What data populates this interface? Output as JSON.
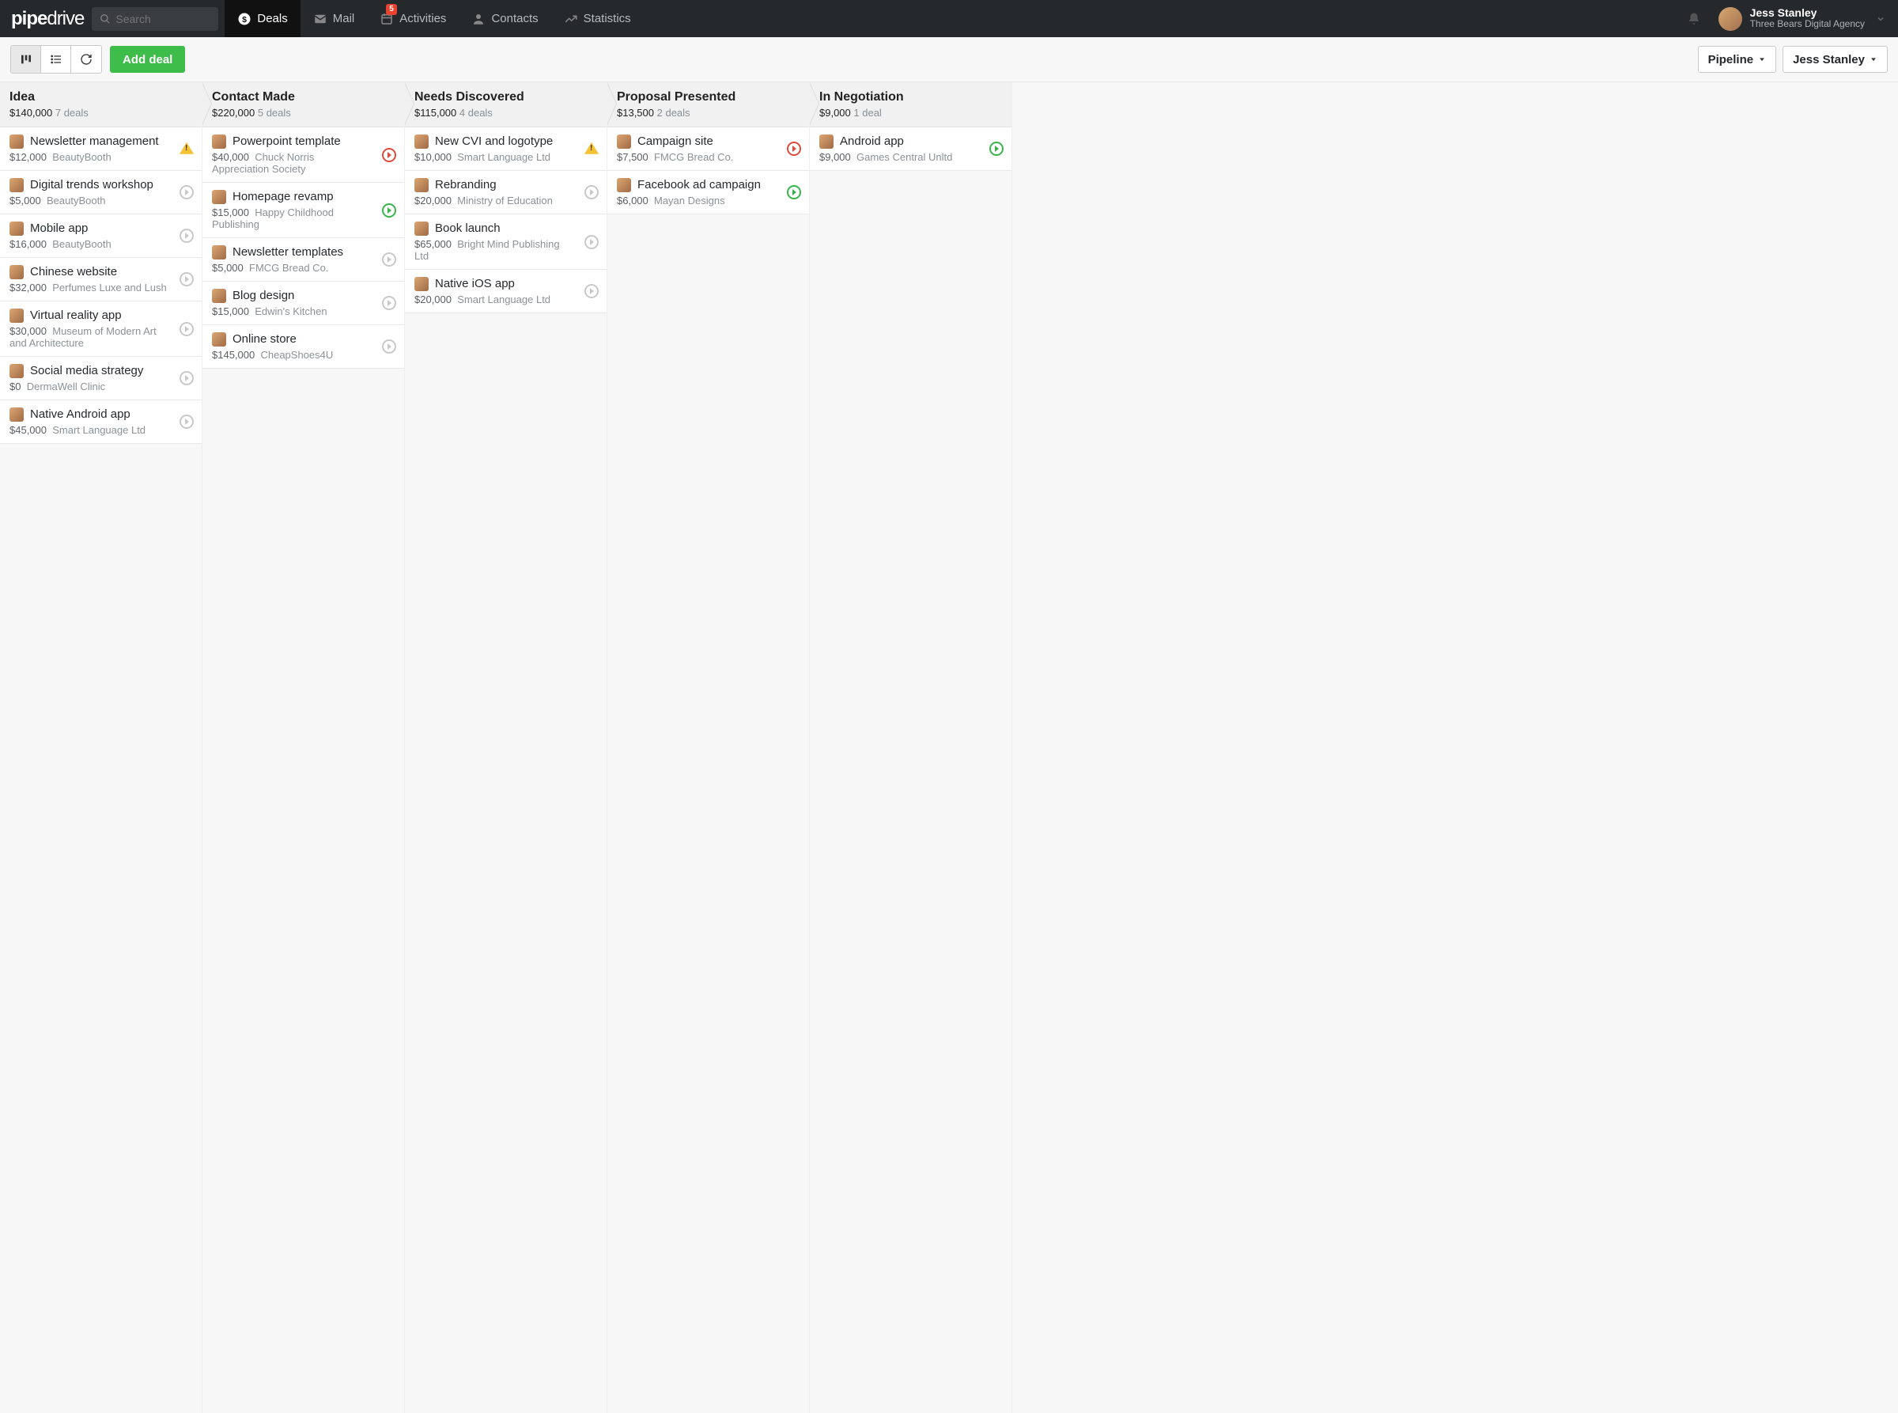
{
  "search_placeholder": "Search",
  "nav": {
    "deals": "Deals",
    "mail": "Mail",
    "activities": "Activities",
    "activities_badge": "5",
    "contacts": "Contacts",
    "statistics": "Statistics"
  },
  "user": {
    "name": "Jess Stanley",
    "org": "Three Bears Digital Agency"
  },
  "toolbar": {
    "add_deal": "Add deal",
    "pipeline": "Pipeline",
    "owner": "Jess Stanley"
  },
  "stages": [
    {
      "title": "Idea",
      "total": "$140,000",
      "count": "7 deals",
      "deals": [
        {
          "title": "Newsletter management",
          "amount": "$12,000",
          "org": "BeautyBooth",
          "status": "warn"
        },
        {
          "title": "Digital trends workshop",
          "amount": "$5,000",
          "org": "BeautyBooth",
          "status": "gray"
        },
        {
          "title": "Mobile app",
          "amount": "$16,000",
          "org": "BeautyBooth",
          "status": "gray"
        },
        {
          "title": "Chinese website",
          "amount": "$32,000",
          "org": "Perfumes Luxe and Lush",
          "status": "gray"
        },
        {
          "title": "Virtual reality app",
          "amount": "$30,000",
          "org": "Museum of Modern Art and Architecture",
          "status": "gray"
        },
        {
          "title": "Social media strategy",
          "amount": "$0",
          "org": "DermaWell Clinic",
          "status": "gray"
        },
        {
          "title": "Native Android app",
          "amount": "$45,000",
          "org": "Smart Language Ltd",
          "status": "gray"
        }
      ]
    },
    {
      "title": "Contact Made",
      "total": "$220,000",
      "count": "5 deals",
      "deals": [
        {
          "title": "Powerpoint template",
          "amount": "$40,000",
          "org": "Chuck Norris Appreciation Society",
          "status": "red"
        },
        {
          "title": "Homepage revamp",
          "amount": "$15,000",
          "org": "Happy Childhood Publishing",
          "status": "green"
        },
        {
          "title": "Newsletter templates",
          "amount": "$5,000",
          "org": "FMCG Bread Co.",
          "status": "gray"
        },
        {
          "title": "Blog design",
          "amount": "$15,000",
          "org": "Edwin's Kitchen",
          "status": "gray"
        },
        {
          "title": "Online store",
          "amount": "$145,000",
          "org": "CheapShoes4U",
          "status": "gray"
        }
      ]
    },
    {
      "title": "Needs Discovered",
      "total": "$115,000",
      "count": "4 deals",
      "deals": [
        {
          "title": "New CVI and logotype",
          "amount": "$10,000",
          "org": "Smart Language Ltd",
          "status": "warn"
        },
        {
          "title": "Rebranding",
          "amount": "$20,000",
          "org": "Ministry of Education",
          "status": "gray"
        },
        {
          "title": "Book launch",
          "amount": "$65,000",
          "org": "Bright Mind Publishing Ltd",
          "status": "gray"
        },
        {
          "title": "Native iOS app",
          "amount": "$20,000",
          "org": "Smart Language Ltd",
          "status": "gray"
        }
      ]
    },
    {
      "title": "Proposal Presented",
      "total": "$13,500",
      "count": "2 deals",
      "deals": [
        {
          "title": "Campaign site",
          "amount": "$7,500",
          "org": "FMCG Bread Co.",
          "status": "red"
        },
        {
          "title": "Facebook ad campaign",
          "amount": "$6,000",
          "org": "Mayan Designs",
          "status": "green"
        }
      ]
    },
    {
      "title": "In Negotiation",
      "total": "$9,000",
      "count": "1 deal",
      "deals": [
        {
          "title": "Android app",
          "amount": "$9,000",
          "org": "Games Central Unltd",
          "status": "green"
        }
      ]
    }
  ]
}
